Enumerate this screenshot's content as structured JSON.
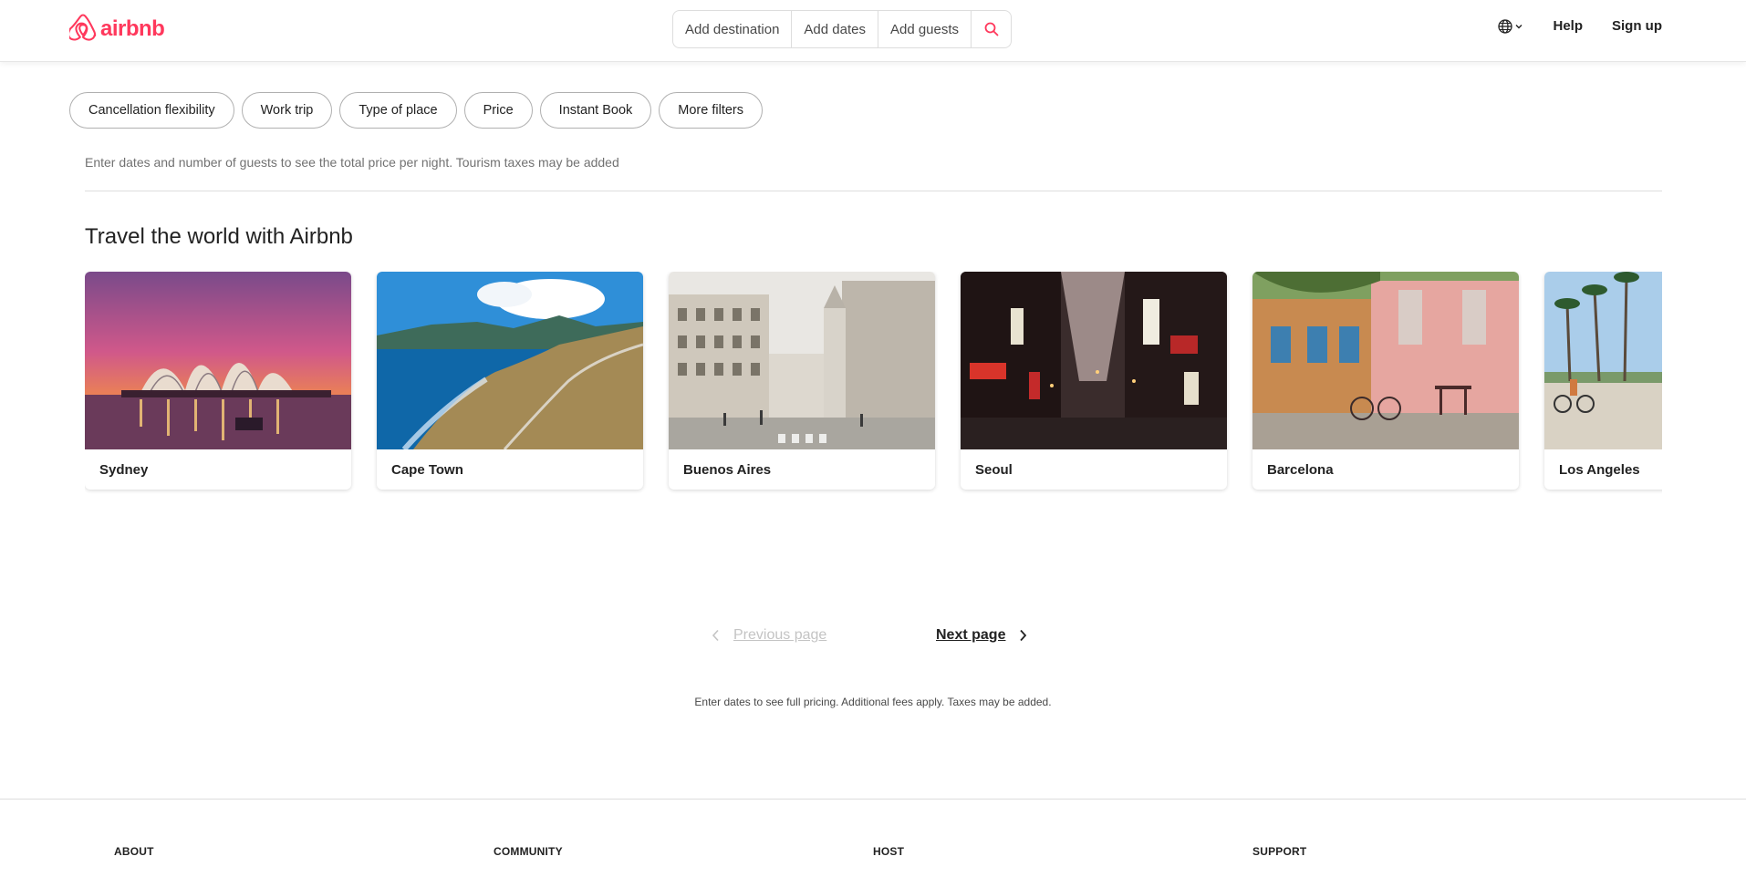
{
  "header": {
    "logo_text": "airbnb",
    "search": {
      "destination": "Add destination",
      "dates": "Add dates",
      "guests": "Add guests"
    },
    "nav": {
      "help": "Help",
      "signup": "Sign up"
    }
  },
  "filters": [
    "Cancellation flexibility",
    "Work trip",
    "Type of place",
    "Price",
    "Instant Book",
    "More filters"
  ],
  "notice": "Enter dates and number of guests to see the total price per night. Tourism taxes may be added",
  "section_title": "Travel the world with Airbnb",
  "destinations": [
    "Sydney",
    "Cape Town",
    "Buenos Aires",
    "Seoul",
    "Barcelona",
    "Los Angeles"
  ],
  "pagination": {
    "previous": "Previous page",
    "next": "Next page"
  },
  "pricing_note": "Enter dates to see full pricing. Additional fees apply. Taxes may be added.",
  "footer": {
    "about": "ABOUT",
    "community": "COMMUNITY",
    "host": "HOST",
    "support": "SUPPORT"
  },
  "colors": {
    "brand": "#ff385c",
    "text": "#222222",
    "muted": "#717171",
    "border": "#dddddd"
  }
}
